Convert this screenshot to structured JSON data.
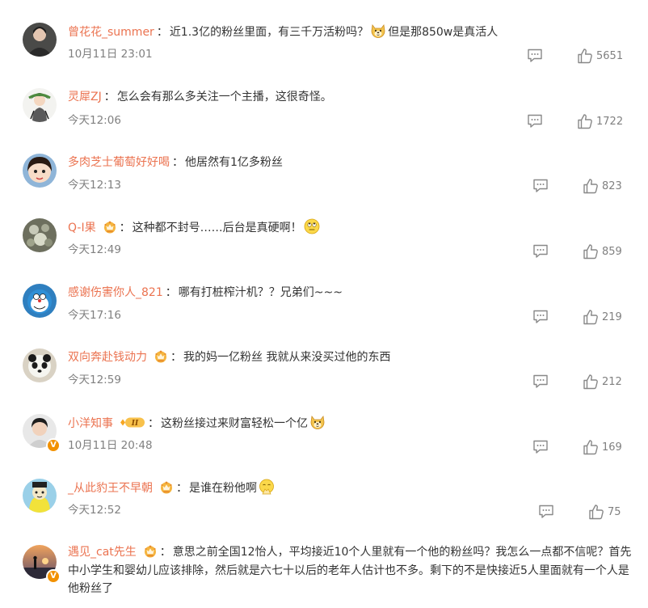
{
  "comments": [
    {
      "username": "曾花花_summer",
      "text_parts": [
        "近1.3亿的粉丝里面，有三千万活粉吗？",
        "但是那850w是真活人"
      ],
      "emoji": "doge-emoji",
      "time": "10月11日 23:01",
      "likes": "5651"
    },
    {
      "username": "灵犀ZJ",
      "text_parts": [
        "怎么会有那么多关注一个主播，这很奇怪。"
      ],
      "time": "今天12:06",
      "likes": "1722"
    },
    {
      "username": "多肉芝士葡萄好好喝",
      "text_parts": [
        "他居然有1亿多粉丝"
      ],
      "time": "今天12:13",
      "likes": "823"
    },
    {
      "username": "Q-I果",
      "text_parts": [
        "这种都不封号……后台是真硬啊！"
      ],
      "emoji": "eye-roll-emoji",
      "vip": true,
      "time": "今天12:49",
      "likes": "859"
    },
    {
      "username": "感谢伤害你人_821",
      "text_parts": [
        "哪有打桩榨汁机？？兄弟们~~~"
      ],
      "time": "今天17:16",
      "likes": "219"
    },
    {
      "username": "双向奔赴钱动力",
      "text_parts": [
        "我的妈一亿粉丝 我就从来没买过他的东西"
      ],
      "vip": true,
      "time": "今天12:59",
      "likes": "212"
    },
    {
      "username": "小洋知事",
      "text_parts": [
        "这粉丝接过来财富轻松一个亿"
      ],
      "emoji": "doge-emoji",
      "vip_tag": "II",
      "verified": "V",
      "time": "10月11日 20:48",
      "likes": "169"
    },
    {
      "username": "_从此豹王不早朝",
      "text_parts": [
        "是谁在粉他啊"
      ],
      "emoji": "pray-emoji",
      "vip": true,
      "time": "今天12:52",
      "likes": "75"
    },
    {
      "username": "遇见_cat先生",
      "text_parts": [
        "意思之前全国12怡人，平均接近10个人里就有一个他的粉丝吗？我怎么一点都不信呢？首先中小学生和婴幼儿应该排除，然后就是六七十以后的老年人估计也不多。剩下的不是快接近5人里面就有一个人是他粉丝了"
      ],
      "vip": true,
      "verified": "V"
    }
  ],
  "colors": {
    "username": "#eb7350",
    "text": "#333333",
    "meta": "#808080",
    "verified_badge": "#f29100"
  },
  "icons": {
    "reply": "comment-icon",
    "like": "thumbs-up-icon",
    "vip": "crown-icon"
  }
}
